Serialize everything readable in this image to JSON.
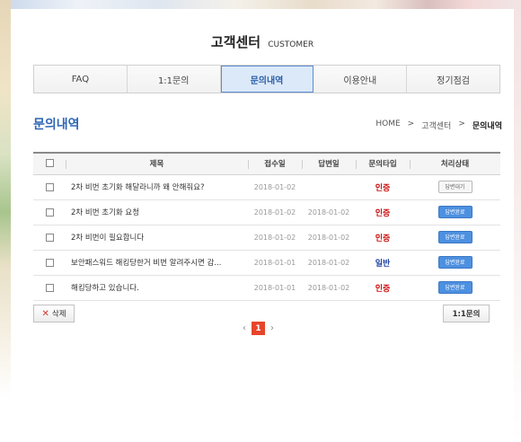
{
  "header": {
    "title_ko": "고객센터",
    "title_en": "CUSTOMER"
  },
  "tabs": [
    {
      "label": "FAQ",
      "active": false
    },
    {
      "label": "1:1문의",
      "active": false
    },
    {
      "label": "문의내역",
      "active": true
    },
    {
      "label": "이용안내",
      "active": false
    },
    {
      "label": "정기점검",
      "active": false
    }
  ],
  "section": {
    "title": "문의내역"
  },
  "breadcrumb": {
    "home": "HOME",
    "sep": ">",
    "parent": "고객센터",
    "current": "문의내역"
  },
  "table": {
    "headers": [
      "제목",
      "접수일",
      "답변일",
      "문의타입",
      "처리상태"
    ],
    "rows": [
      {
        "subject": "2차 비번 초기화 해달라니까 왜 안해줘요?",
        "received": "2018-01-02",
        "answered": "",
        "type": "인증",
        "status": "답변대기"
      },
      {
        "subject": "2차 비번 초기화 요청",
        "received": "2018-01-02",
        "answered": "2018-01-02",
        "type": "인증",
        "status": "답변완료"
      },
      {
        "subject": "2차 비번이 필요합니다",
        "received": "2018-01-02",
        "answered": "2018-01-02",
        "type": "인증",
        "status": "답변완료"
      },
      {
        "subject": "보안패스워드 해킹당한거 비번 알려주시면 감...",
        "received": "2018-01-01",
        "answered": "2018-01-02",
        "type": "일반",
        "status": "답변완료"
      },
      {
        "subject": "해킹당하고 있습니다.",
        "received": "2018-01-01",
        "answered": "2018-01-02",
        "type": "인증",
        "status": "답변완료"
      }
    ]
  },
  "buttons": {
    "delete": "삭제",
    "inquiry": "1:1문의"
  },
  "pagination": {
    "current": "1",
    "prev": "‹",
    "next": "›"
  },
  "colors": {
    "accent_blue": "#2e66b5",
    "type_auth": "#cc1111",
    "type_general": "#1a3fa0",
    "status_done": "#4d90e0",
    "page_active": "#e6452b"
  }
}
